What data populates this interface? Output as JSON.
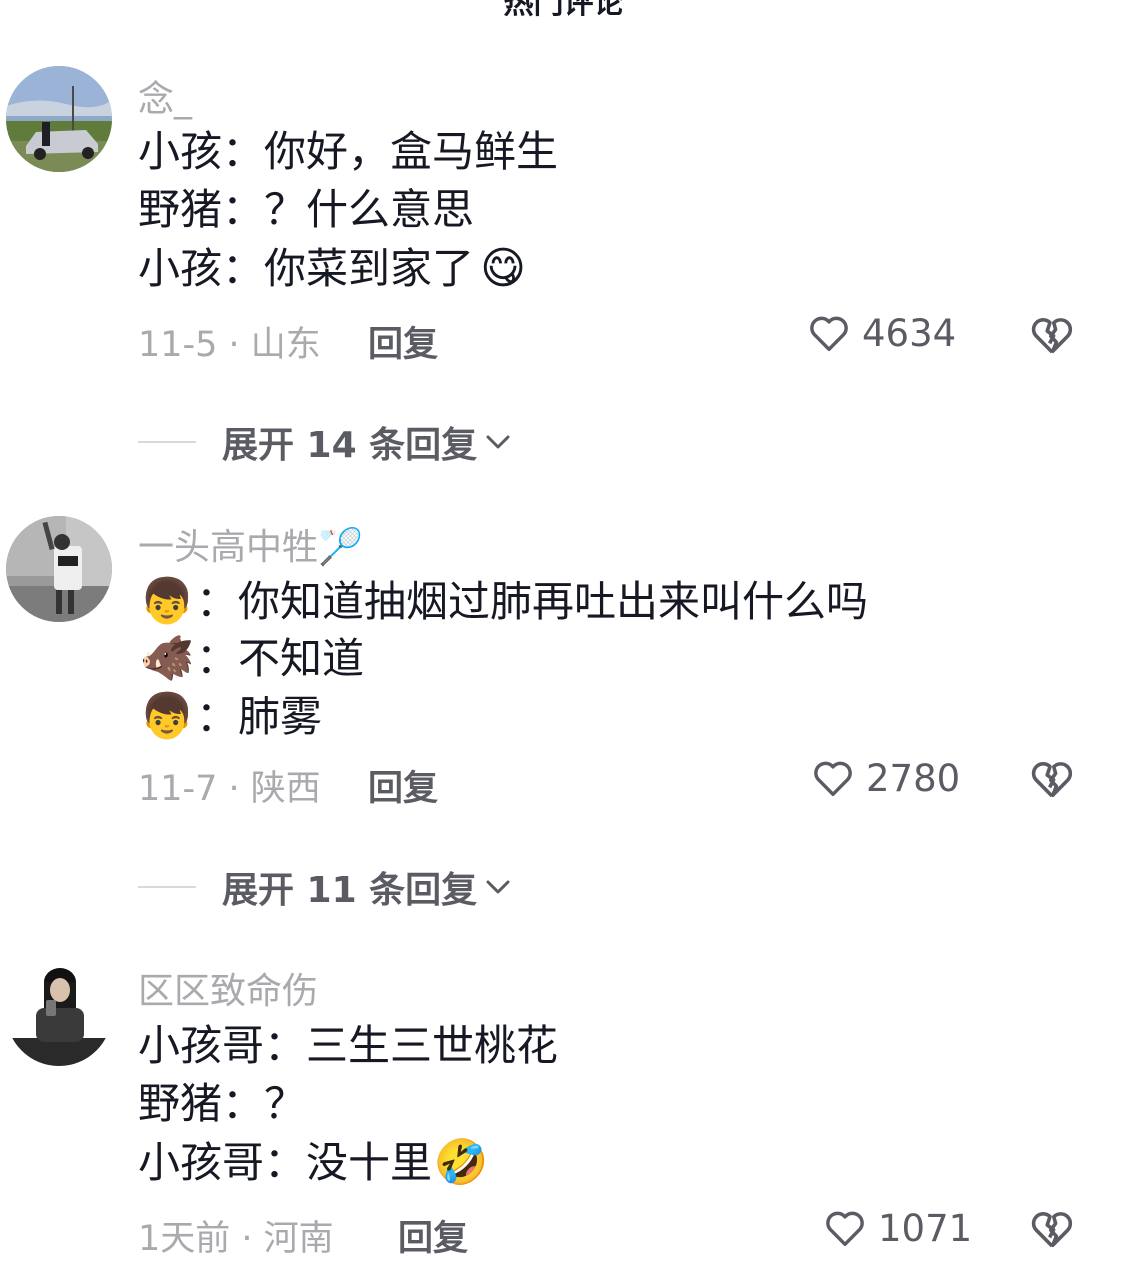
{
  "header": {
    "title_partial": "热门评论"
  },
  "comments": [
    {
      "username": "念_",
      "lines": [
        {
          "emoji": "",
          "text": "小孩：你好，盒马鲜生",
          "trail": ""
        },
        {
          "emoji": "",
          "text": "野猪：？什么意思",
          "trail": ""
        },
        {
          "emoji": "",
          "text": "小孩：你菜到家了",
          "trail": "😋"
        }
      ],
      "meta": "11-5 · 山东",
      "reply_label": "回复",
      "likes": "4634",
      "expand": "展开 14 条回复"
    },
    {
      "username": "一头高中牲🏸",
      "lines": [
        {
          "emoji": "👦",
          "text": "：你知道抽烟过肺再吐出来叫什么吗",
          "trail": ""
        },
        {
          "emoji": "🐗",
          "text": "：不知道",
          "trail": ""
        },
        {
          "emoji": "👦",
          "text": "：肺雾",
          "trail": ""
        }
      ],
      "meta": "11-7 · 陕西",
      "reply_label": "回复",
      "likes": "2780",
      "expand": "展开 11 条回复"
    },
    {
      "username": "区区致命伤",
      "lines": [
        {
          "emoji": "",
          "text": "小孩哥：三生三世桃花",
          "trail": ""
        },
        {
          "emoji": "",
          "text": "野猪：？",
          "trail": ""
        },
        {
          "emoji": "",
          "text": "小孩哥：没十里",
          "trail": "🤣"
        }
      ],
      "meta": "1天前 · 河南",
      "reply_label": "回复",
      "likes": "1071",
      "expand": ""
    }
  ],
  "colors": {
    "text": "#161823",
    "secondary": "#a9a9ae",
    "action": "#5b5c63"
  },
  "icons": {
    "like": "heart-outline-icon",
    "dislike": "broken-heart-icon",
    "expand": "chevron-down-icon"
  }
}
